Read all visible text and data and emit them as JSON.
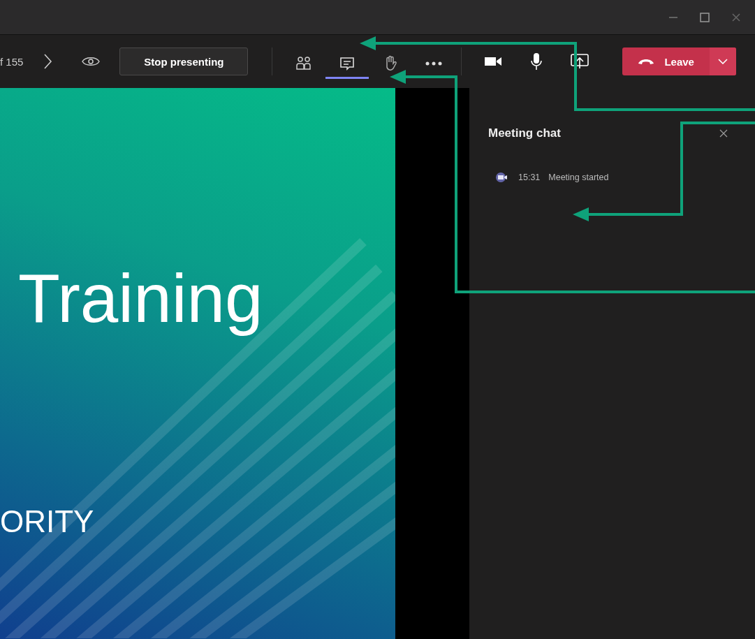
{
  "toolbar": {
    "page_counter": "f 155",
    "stop_button": "Stop presenting",
    "buttons": [
      {
        "kind": "people",
        "selected": false
      },
      {
        "kind": "chat",
        "selected": true
      },
      {
        "kind": "hand",
        "selected": false
      },
      {
        "kind": "more",
        "selected": false
      }
    ],
    "leave_button": "Leave"
  },
  "slide": {
    "title": "Training",
    "subtitle": "ORITY"
  },
  "chat": {
    "title": "Meeting chat",
    "events": [
      {
        "time": "15:31",
        "text": "Meeting started"
      }
    ]
  }
}
